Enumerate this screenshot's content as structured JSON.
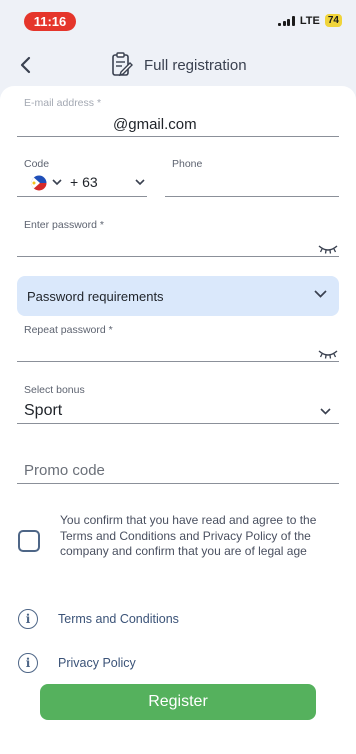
{
  "status_bar": {
    "time": "11:16",
    "network": "LTE",
    "battery": "74"
  },
  "header": {
    "back_icon": "chevron-left-icon",
    "logo_icon": "registration-form-icon",
    "title": "Full registration"
  },
  "form": {
    "email": {
      "label": "E-mail address *",
      "value": "@gmail.com"
    },
    "code": {
      "label": "Code",
      "flag": "philippines-flag-icon",
      "value": "+ 63"
    },
    "phone": {
      "label": "Phone",
      "value": ""
    },
    "password": {
      "label": "Enter password *",
      "value": ""
    },
    "password_requirements": {
      "label": "Password requirements"
    },
    "repeat_password": {
      "label": "Repeat password *",
      "value": ""
    },
    "bonus": {
      "label": "Select bonus",
      "value": "Sport"
    },
    "promo": {
      "placeholder": "Promo code"
    },
    "consent": {
      "text": "You confirm that you have read and agree to the Terms and Conditions and Privacy Policy of the company and confirm that you are of legal age",
      "checked": false
    }
  },
  "links": [
    {
      "label": "Terms and Conditions"
    },
    {
      "label": "Privacy Policy"
    }
  ],
  "register_button": {
    "label": "Register",
    "color": "#55b15d"
  },
  "colors": {
    "accent_blue": "#4e6687",
    "panel_blue": "#dae8fb",
    "status_red": "#e5352b"
  }
}
